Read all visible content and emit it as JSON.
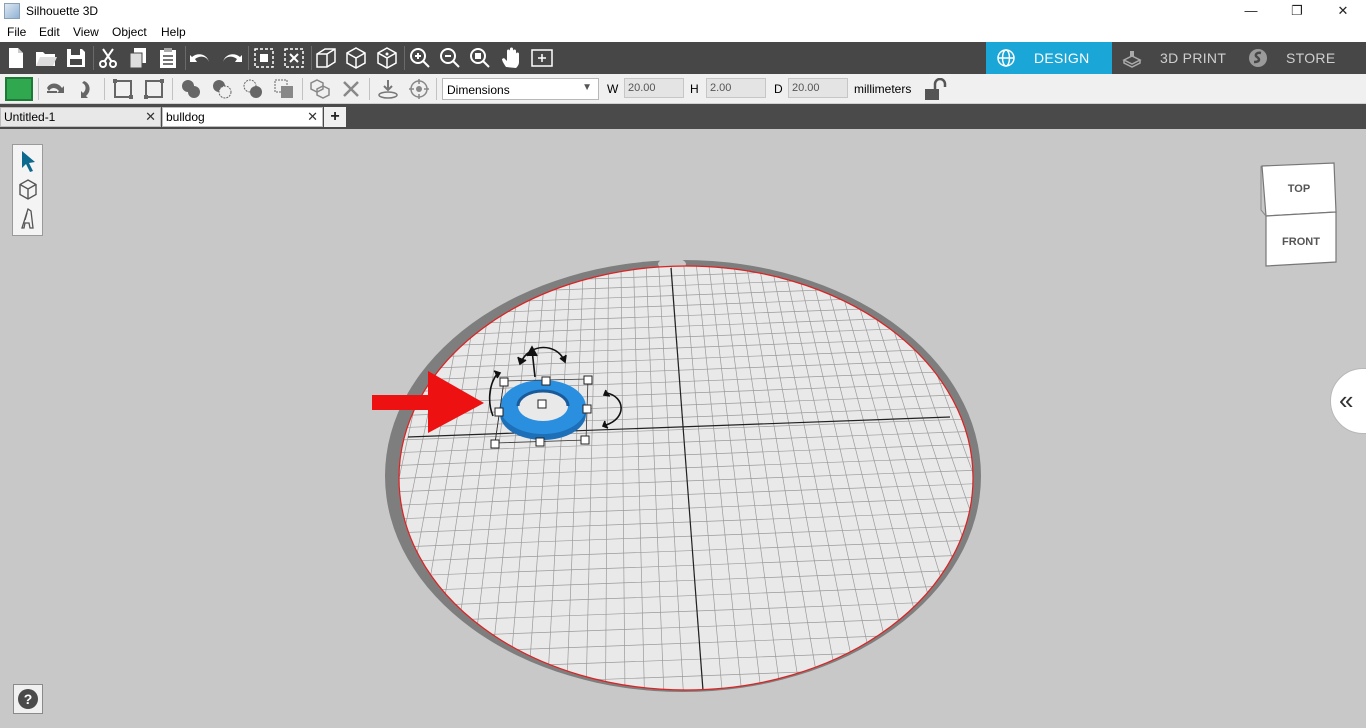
{
  "window": {
    "title": "Silhouette 3D",
    "minimize": "—",
    "restore": "❐",
    "close": "✕"
  },
  "menu": [
    "File",
    "Edit",
    "View",
    "Object",
    "Help"
  ],
  "modes": [
    {
      "label": "DESIGN",
      "icon": "globe-icon",
      "active": true
    },
    {
      "label": "3D PRINT",
      "icon": "printer-icon",
      "active": false
    },
    {
      "label": "STORE",
      "icon": "silhouette-logo-icon",
      "active": false
    }
  ],
  "properties": {
    "color": "#2fa84f",
    "mode_select": "Dimensions",
    "w_label": "W",
    "w_value": "20.00",
    "h_label": "H",
    "h_value": "2.00",
    "d_label": "D",
    "d_value": "20.00",
    "units": "millimeters",
    "aspect_locked": false
  },
  "tabs": [
    {
      "name": "Untitled-1",
      "close": "✕",
      "active": false
    },
    {
      "name": "bulldog",
      "close": "✕",
      "active": true
    }
  ],
  "add_tab": "+",
  "viewcube": {
    "top": "TOP",
    "front": "FRONT"
  },
  "help": "?",
  "expand": "«",
  "colors": {
    "accent": "#1aa6d6",
    "object": "#2b8fe0",
    "arrow": "#ee1111",
    "toolbar": "#474747"
  }
}
